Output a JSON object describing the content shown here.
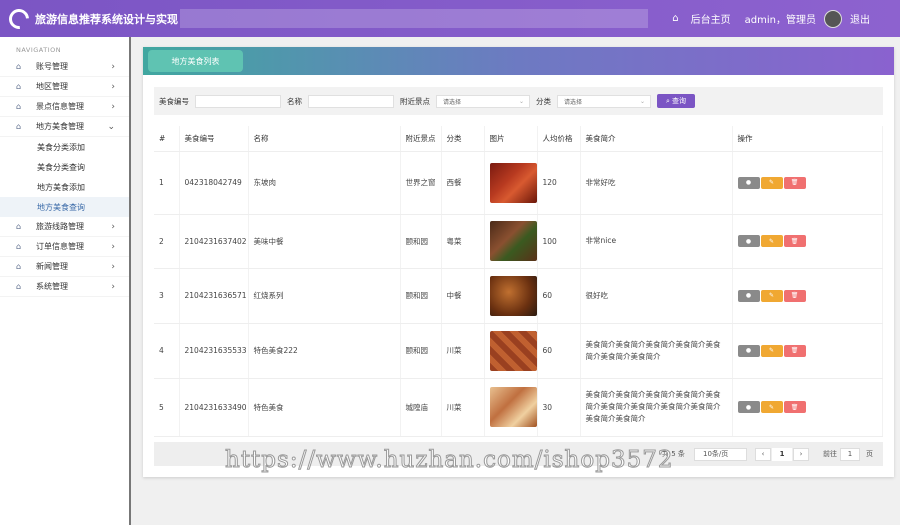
{
  "header": {
    "title": "旅游信息推荐系统设计与实现",
    "home_label": "后台主页",
    "user_label": "admin，管理员",
    "logout_label": "退出"
  },
  "sidebar": {
    "nav_title": "NAVIGATION",
    "items": [
      {
        "label": "账号管理"
      },
      {
        "label": "地区管理"
      },
      {
        "label": "景点信息管理"
      },
      {
        "label": "地方美食管理"
      }
    ],
    "sub_items": [
      {
        "label": "美食分类添加"
      },
      {
        "label": "美食分类查询"
      },
      {
        "label": "地方美食添加"
      },
      {
        "label": "地方美食查询"
      }
    ],
    "items_after": [
      {
        "label": "旅游线路管理"
      },
      {
        "label": "订单信息管理"
      },
      {
        "label": "新闻管理"
      },
      {
        "label": "系统管理"
      }
    ]
  },
  "main": {
    "tab_label": "地方美食列表",
    "search": {
      "code_label": "美食编号",
      "name_label": "名称",
      "spot_label": "附近景点",
      "spot_placeholder": "请选择",
      "category_label": "分类",
      "category_placeholder": "请选择",
      "query_label": "查询"
    },
    "table": {
      "headers": [
        "#",
        "美食编号",
        "名称",
        "附近景点",
        "分类",
        "图片",
        "人均价格",
        "美食简介",
        "操作"
      ],
      "rows": [
        {
          "idx": "1",
          "code": "042318042749",
          "name": "东坡肉",
          "spot": "世界之窗",
          "cat": "西餐",
          "price": "120",
          "intro": "非常好吃"
        },
        {
          "idx": "2",
          "code": "2104231637402",
          "name": "美味中餐",
          "spot": "颐和园",
          "cat": "粤菜",
          "price": "100",
          "intro": "非常nice"
        },
        {
          "idx": "3",
          "code": "2104231636571",
          "name": "红烧系列",
          "spot": "颐和园",
          "cat": "中餐",
          "price": "60",
          "intro": "很好吃"
        },
        {
          "idx": "4",
          "code": "2104231635533",
          "name": "特色美食222",
          "spot": "颐和园",
          "cat": "川菜",
          "price": "60",
          "intro": "美食简介美食简介美食简介美食简介美食简介美食简介美食简介"
        },
        {
          "idx": "5",
          "code": "2104231633490",
          "name": "特色美食",
          "spot": "城隍庙",
          "cat": "川菜",
          "price": "30",
          "intro": "美食简介美食简介美食简介美食简介美食简介美食简介美食简介美食简介美食简介美食简介美食简介"
        }
      ]
    },
    "pager": {
      "total": "共 5 条",
      "page_size": "10条/页",
      "current": "1",
      "goto_label": "前往",
      "goto_value": "1",
      "page_unit": "页"
    }
  },
  "watermark": "https://www.huzhan.com/ishop3572",
  "colors": {
    "header": "#7b55c4",
    "tab": "#5fc3b2",
    "query": "#7b55c4",
    "info": "#8a8a8a",
    "edit": "#f0a832",
    "delete": "#f07070"
  }
}
